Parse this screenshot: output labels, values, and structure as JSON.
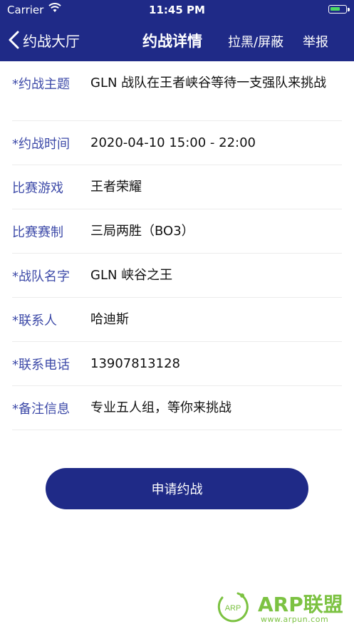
{
  "status": {
    "carrier": "Carrier",
    "time": "11:45 PM",
    "battery_level": 0.7
  },
  "nav": {
    "back_label": "约战大厅",
    "title": "约战详情",
    "block_label": "拉黑/屏蔽",
    "report_label": "举报"
  },
  "details": {
    "rows": [
      {
        "label": "*约战主题",
        "value": "GLN 战队在王者峡谷等待一支强队来挑战"
      },
      {
        "label": "*约战时间",
        "value": "2020-04-10 15:00 - 22:00"
      },
      {
        "label": "比赛游戏",
        "value": "王者荣耀"
      },
      {
        "label": "比赛赛制",
        "value": "三局两胜（BO3）"
      },
      {
        "label": "*战队名字",
        "value": "GLN 峡谷之王"
      },
      {
        "label": "*联系人",
        "value": "哈迪斯"
      },
      {
        "label": "*联系电话",
        "value": "13907813128"
      },
      {
        "label": "*备注信息",
        "value": "专业五人组，等你来挑战"
      }
    ]
  },
  "actions": {
    "apply_label": "申请约战"
  },
  "watermark": {
    "logo_text": "ARP",
    "brand": "ARP联盟",
    "url": "www.arpun.com"
  },
  "colors": {
    "primary": "#1f2a87",
    "label": "#3d4aa8",
    "watermark": "#7cc242"
  }
}
